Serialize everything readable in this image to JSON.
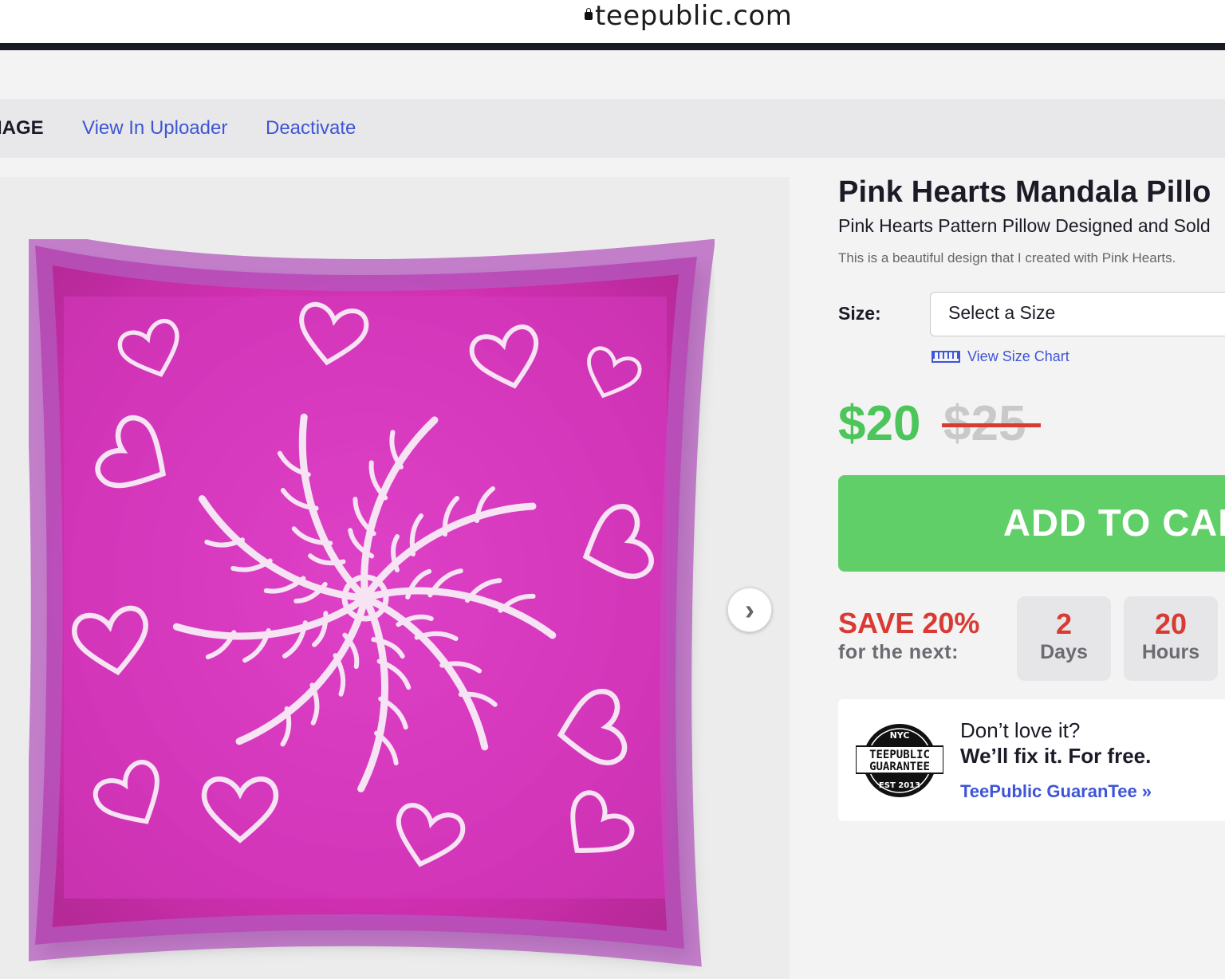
{
  "browser": {
    "url": "teepublic.com"
  },
  "admin_bar": {
    "cut_label": "IAGE",
    "links": [
      "View In Uploader",
      "Deactivate"
    ]
  },
  "product": {
    "title": "Pink Hearts Mandala Pillo",
    "subtitle": "Pink Hearts Pattern Pillow Designed and Sold",
    "description": "This is a beautiful design that I created with Pink Hearts.",
    "image_colors": {
      "pillow_edge": "#b459be",
      "pillow_center": "#e238c6",
      "pillow_outer": "#cf2fb0",
      "pattern": "#f6e3f3"
    }
  },
  "size": {
    "label": "Size:",
    "placeholder": "Select a Size",
    "chart_link": "View Size Chart"
  },
  "price": {
    "current": "$20",
    "original": "$25"
  },
  "cart": {
    "label": "ADD TO CART"
  },
  "sale": {
    "headline": "SAVE 20%",
    "sub": "for the next:",
    "countdown": [
      {
        "value": "2",
        "unit": "Days"
      },
      {
        "value": "20",
        "unit": "Hours"
      }
    ]
  },
  "guarantee": {
    "line1": "Don’t love it?",
    "line2": "We’ll fix it. For free.",
    "link": "TeePublic GuaranTee »",
    "badge_top": "NYC",
    "badge_mid1": "TEEPUBLIC",
    "badge_mid2": "GUARANTEE",
    "badge_bottom": "EST 2013"
  },
  "colors": {
    "accent_blue": "#3d55d6",
    "price_green": "#4cc55a",
    "sale_red": "#d93a33",
    "cart_green": "#61cf67"
  }
}
